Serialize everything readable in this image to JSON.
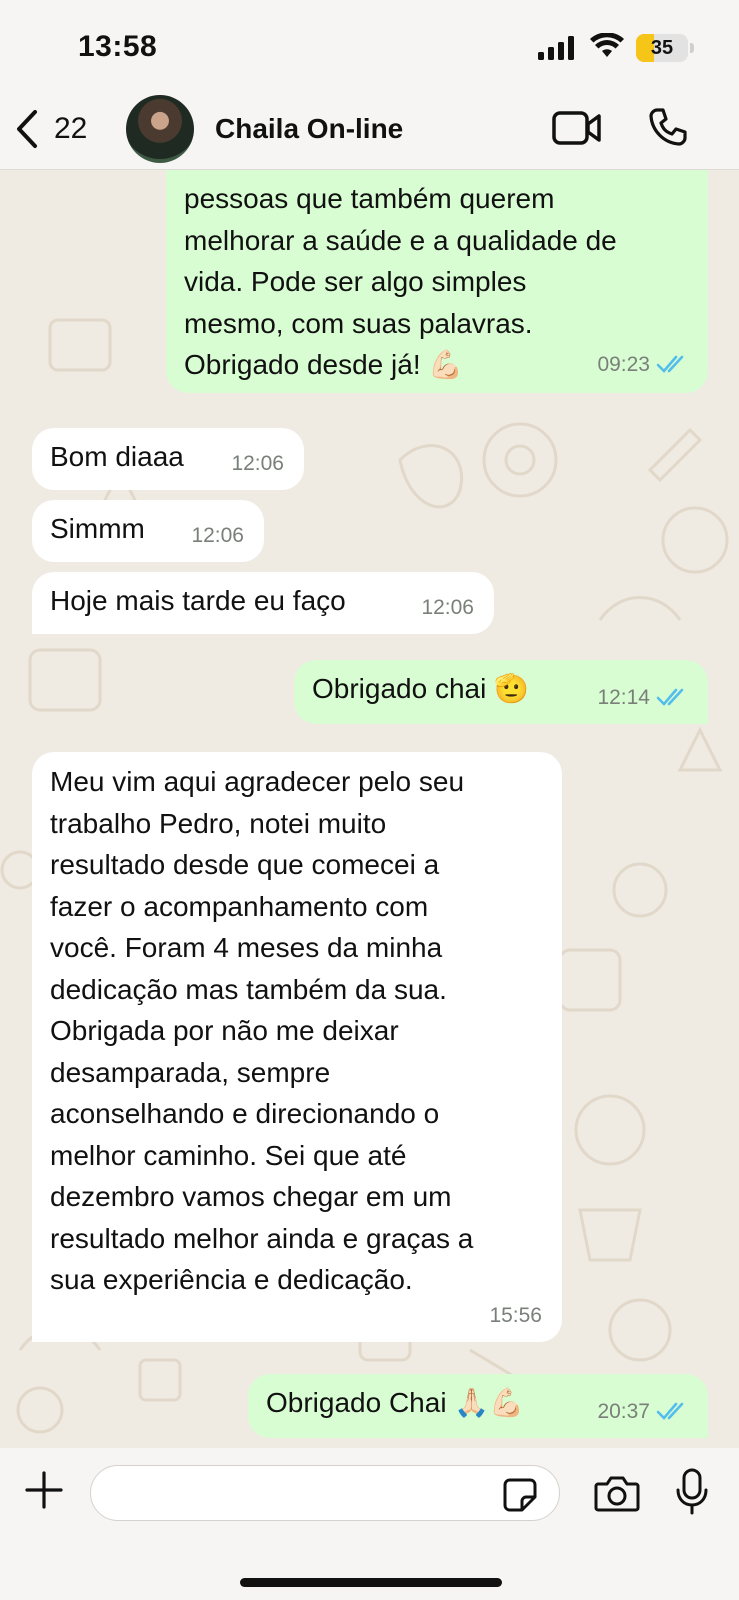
{
  "status_bar": {
    "time": "13:58",
    "battery_level": "35",
    "battery_fraction": 0.35
  },
  "header": {
    "back_count": "22",
    "contact_name": "Chaila On-line"
  },
  "messages": [
    {
      "direction": "outgoing",
      "text": "pessoas que também querem\nmelhorar a saúde e a qualidade de\nvida. Pode ser algo simples\nmesmo, com suas palavras.\nObrigado desde já! 💪🏻",
      "time": "09:23",
      "status": "read"
    },
    {
      "direction": "incoming",
      "text": "Bom diaaa",
      "time": "12:06"
    },
    {
      "direction": "incoming",
      "text": "Simmm",
      "time": "12:06"
    },
    {
      "direction": "incoming",
      "text": "Hoje mais tarde eu faço",
      "time": "12:06"
    },
    {
      "direction": "outgoing",
      "text": "Obrigado chai 🫡",
      "time": "12:14",
      "status": "read"
    },
    {
      "direction": "incoming",
      "text": "Meu vim aqui agradecer pelo seu\ntrabalho Pedro, notei muito\nresultado desde que comecei a\nfazer o acompanhamento com\nvocê. Foram 4 meses da minha\ndedicação mas também da sua.\nObrigada por não me deixar\ndesamparada, sempre\naconselhando e direcionando o\nmelhor caminho. Sei que até\ndezembro vamos chegar em um\nresultado melhor ainda e graças a\nsua experiência e dedicação.",
      "time": "15:56"
    },
    {
      "direction": "outgoing",
      "text": "Obrigado Chai 🙏🏻💪🏻",
      "time": "20:37",
      "status": "read"
    }
  ],
  "composer": {
    "placeholder": ""
  },
  "colors": {
    "outgoing_bubble": "#d9fdd3",
    "incoming_bubble": "#ffffff",
    "read_ticks": "#53bdeb",
    "chat_background": "#efeae2"
  },
  "icons": [
    "chevron-left-icon",
    "video-camera-icon",
    "phone-icon",
    "plus-icon",
    "sticker-icon",
    "camera-icon",
    "microphone-icon",
    "signal-icon",
    "wifi-icon",
    "battery-icon",
    "double-check-icon"
  ]
}
